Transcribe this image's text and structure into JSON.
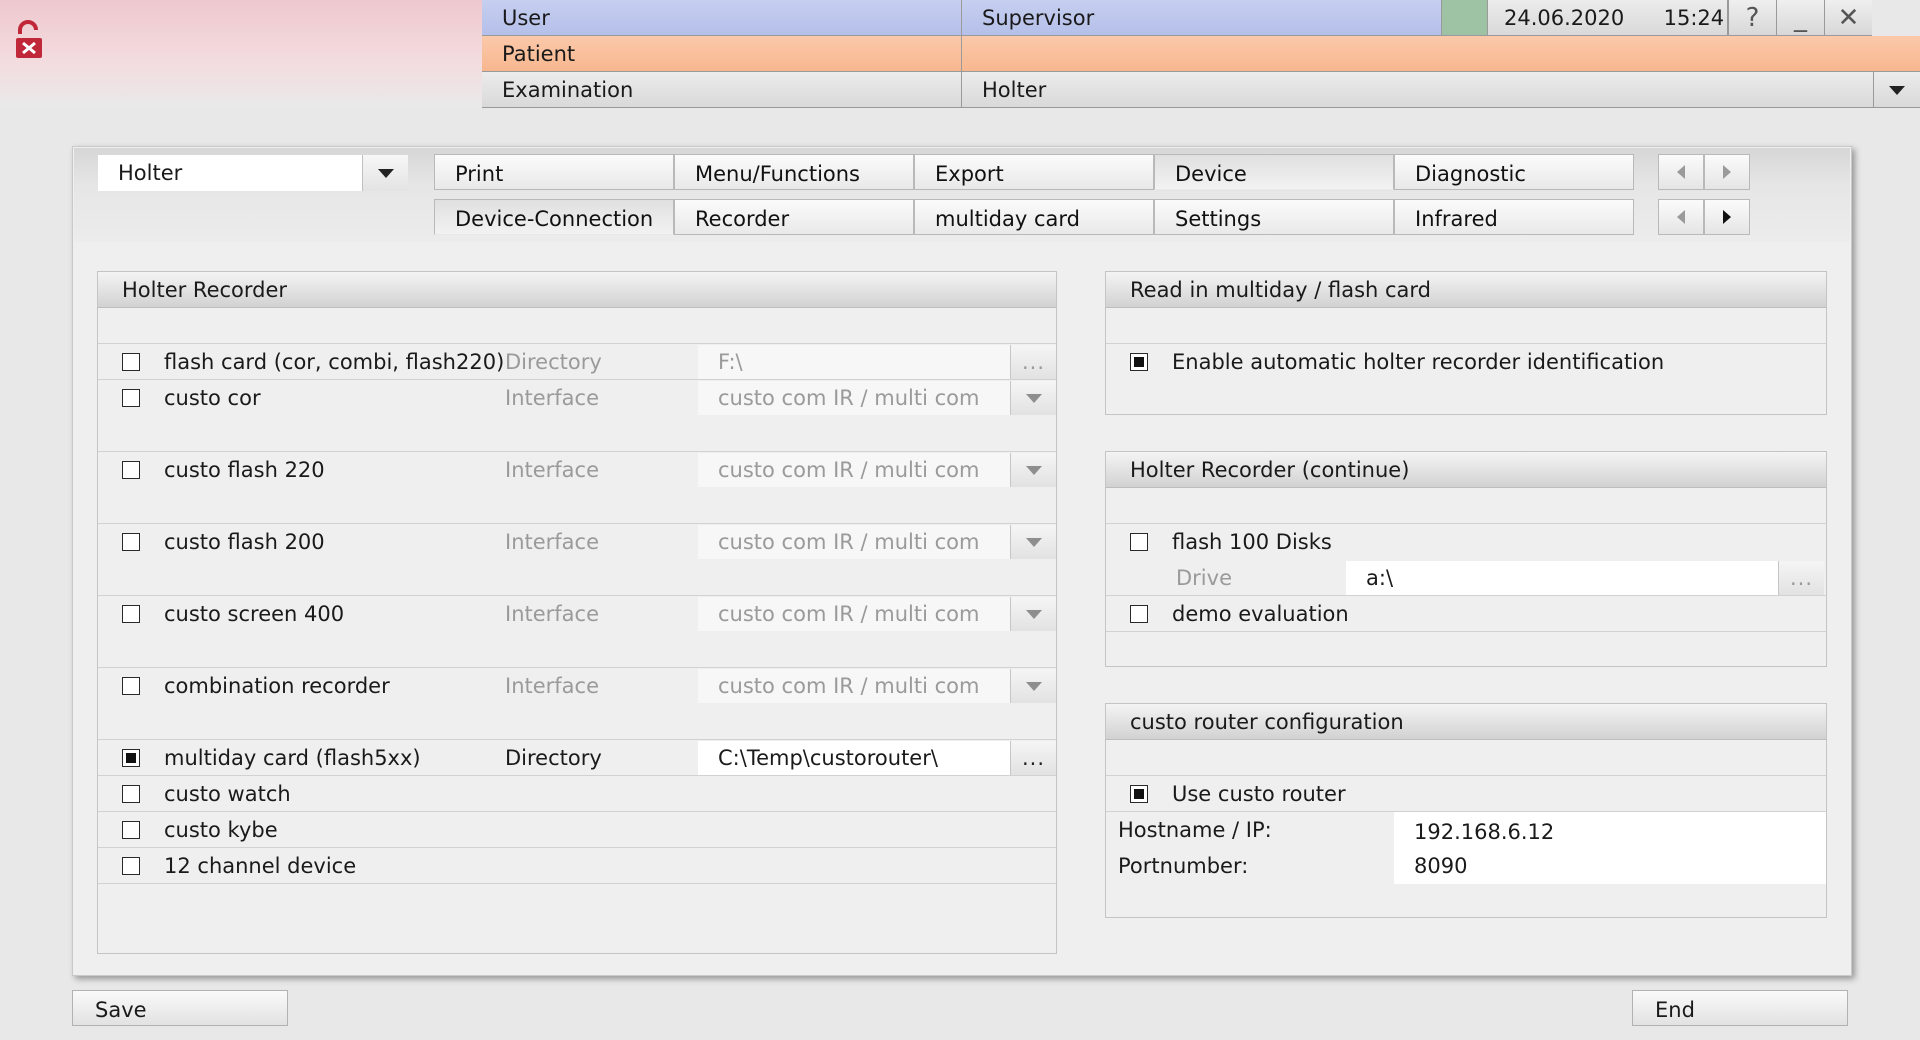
{
  "header": {
    "user_label": "User",
    "user_value": "Supervisor",
    "date": "24.06.2020",
    "time": "15:24",
    "help_glyph": "?",
    "minimize_glyph": "_",
    "close_glyph": "✕",
    "patient_label": "Patient",
    "patient_value": "",
    "examination_label": "Examination",
    "examination_value": "Holter"
  },
  "module_select": {
    "value": "Holter"
  },
  "tabs_row1": [
    "Print",
    "Menu/Functions",
    "Export",
    "Device",
    "Diagnostic"
  ],
  "tabs_row2": [
    "Device-Connection",
    "Recorder",
    "multiday card",
    "Settings",
    "Infrared"
  ],
  "holter_recorder": {
    "title": "Holter Recorder",
    "devices": [
      {
        "label": "flash card (cor, combi, flash220)",
        "checked": false,
        "field_label": "Directory",
        "field_value": "F:\\",
        "button": "...",
        "enabled": false
      },
      {
        "label": "custo cor",
        "checked": false,
        "field_label": "Interface",
        "field_value": "custo com IR / multi com",
        "enabled": false
      },
      {
        "label": "custo flash 220",
        "checked": false,
        "field_label": "Interface",
        "field_value": "custo com IR / multi com",
        "enabled": false
      },
      {
        "label": "custo flash 200",
        "checked": false,
        "field_label": "Interface",
        "field_value": "custo com IR / multi com",
        "enabled": false
      },
      {
        "label": "custo screen 400",
        "checked": false,
        "field_label": "Interface",
        "field_value": "custo com IR / multi com",
        "enabled": false
      },
      {
        "label": "combination recorder",
        "checked": false,
        "field_label": "Interface",
        "field_value": "custo com IR / multi com",
        "enabled": false
      },
      {
        "label": "multiday card (flash5xx)",
        "checked": true,
        "field_label": "Directory",
        "field_value": "C:\\Temp\\custorouter\\",
        "button": "...",
        "enabled": true
      },
      {
        "label": "custo watch",
        "checked": false
      },
      {
        "label": "custo kybe",
        "checked": false
      },
      {
        "label": "12 channel device",
        "checked": false
      }
    ]
  },
  "read_in": {
    "title": "Read in multiday / flash card",
    "auto_id_label": "Enable automatic holter recorder identification",
    "auto_id_checked": true
  },
  "holter_continue": {
    "title": "Holter Recorder (continue)",
    "flash100_label": "flash 100 Disks",
    "flash100_checked": false,
    "drive_label": "Drive",
    "drive_value": "a:\\",
    "drive_button": "...",
    "demo_label": "demo evaluation",
    "demo_checked": false
  },
  "router": {
    "title": "custo router configuration",
    "use_label": "Use custo router",
    "use_checked": true,
    "hostname_label": "Hostname / IP:",
    "hostname_value": "192.168.6.12",
    "port_label": "Portnumber:",
    "port_value": "8090"
  },
  "footer": {
    "save": "Save",
    "end": "End"
  },
  "colors": {
    "user_row": "#b5c0ea",
    "patient_row": "#f7b78f",
    "status_green": "#9ec2a4",
    "lock_red": "#c0283a"
  },
  "icons": {
    "lock": "unlock-x-icon"
  }
}
